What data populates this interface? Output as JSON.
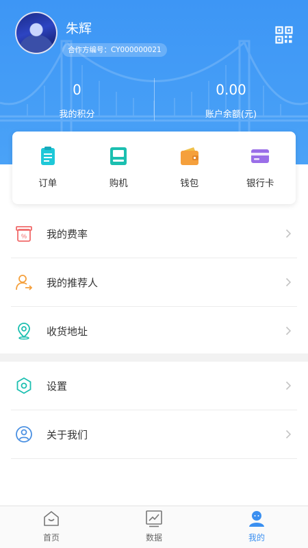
{
  "profile": {
    "name": "朱辉",
    "partner_id": "合作方编号：CY000000021",
    "qr_icon": "qr-code-icon"
  },
  "stats": [
    {
      "value": "0",
      "label": "我的积分"
    },
    {
      "value": "0.00",
      "label": "账户余额(元)"
    }
  ],
  "quick_actions": [
    {
      "label": "订单",
      "icon": "order-icon",
      "color": "#1ec8d8"
    },
    {
      "label": "购机",
      "icon": "pos-machine-icon",
      "color": "#1bbfb0"
    },
    {
      "label": "钱包",
      "icon": "wallet-icon",
      "color": "#f5a03c"
    },
    {
      "label": "银行卡",
      "icon": "bank-card-icon",
      "color": "#9a6ee8"
    }
  ],
  "menu_group_1": [
    {
      "label": "我的费率",
      "icon": "rate-icon"
    },
    {
      "label": "我的推荐人",
      "icon": "referrer-icon"
    },
    {
      "label": "收货地址",
      "icon": "location-icon"
    }
  ],
  "menu_group_2": [
    {
      "label": "设置",
      "icon": "settings-icon"
    },
    {
      "label": "关于我们",
      "icon": "about-icon"
    }
  ],
  "tabs": [
    {
      "label": "首页",
      "icon": "home-icon"
    },
    {
      "label": "数据",
      "icon": "chart-icon"
    },
    {
      "label": "我的",
      "icon": "profile-icon",
      "active": true
    }
  ],
  "colors": {
    "brand_blue": "#3d96f5",
    "active_tab": "#3a8ff0",
    "rate_red": "#f06a6a",
    "referrer_orange": "#f5a03c",
    "location_teal": "#1bbfb0",
    "settings_teal": "#1bbfb0",
    "about_blue": "#4a90e2"
  }
}
